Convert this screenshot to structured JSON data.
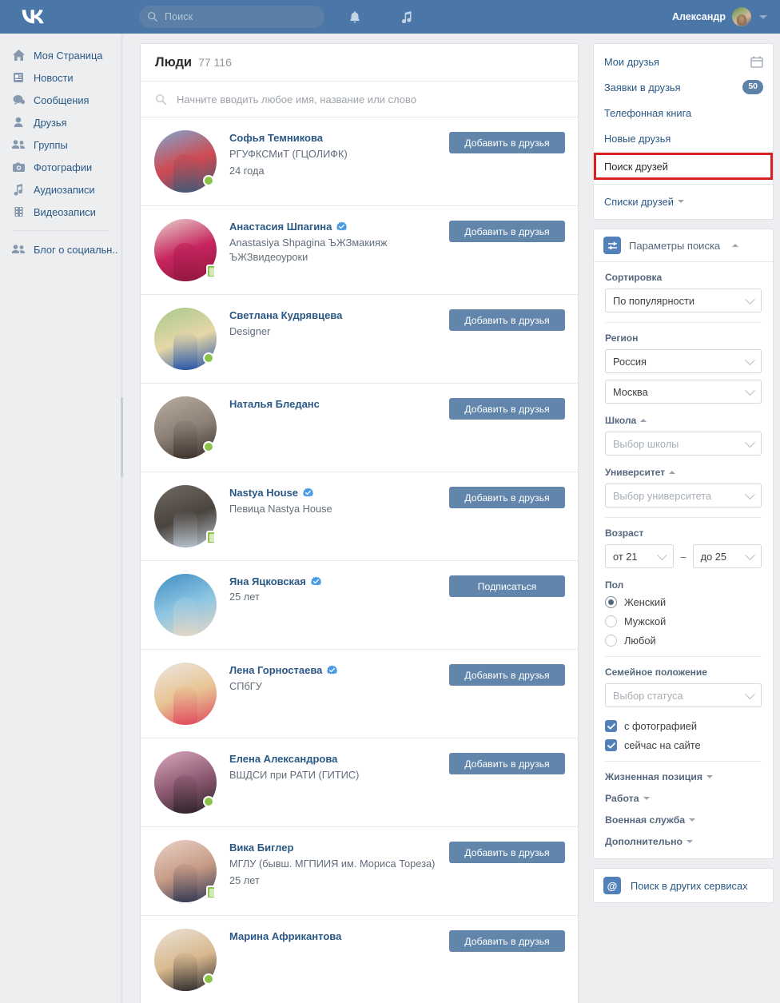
{
  "header": {
    "logo": "vk-logo",
    "search_placeholder": "Поиск",
    "notifications_icon": "bell-icon",
    "music_icon": "music-note-icon",
    "user_name": "Александр"
  },
  "left_nav": {
    "items": [
      {
        "icon": "home-icon",
        "label": "Моя Страница"
      },
      {
        "icon": "news-icon",
        "label": "Новости"
      },
      {
        "icon": "message-icon",
        "label": "Сообщения"
      },
      {
        "icon": "person-icon",
        "label": "Друзья"
      },
      {
        "icon": "people-icon",
        "label": "Группы"
      },
      {
        "icon": "camera-icon",
        "label": "Фотографии"
      },
      {
        "icon": "music-icon",
        "label": "Аудиозаписи"
      },
      {
        "icon": "film-icon",
        "label": "Видеозаписи"
      }
    ],
    "extra": {
      "icon": "people-icon",
      "label": "Блог о социальн.."
    }
  },
  "main": {
    "title": "Люди",
    "count": "77 116",
    "search_placeholder": "Начните вводить любое имя, название или слово",
    "users": [
      {
        "name": "Софья Темникова",
        "verified": false,
        "subtitle": "РГУФКСМиТ (ГЦОЛИФК)",
        "age": "24 года",
        "status": "online",
        "action": "Добавить в друзья",
        "avatar_colors": [
          "#7fa8cf",
          "#cf4a52",
          "#3c5a78"
        ]
      },
      {
        "name": "Анастасия Шпагина",
        "verified": true,
        "subtitle": "Anastasiya Shpagina ЪЖЗмакияж ЪЖЗвидеоуроки",
        "age": "",
        "status": "mobile",
        "action": "Добавить в друзья",
        "avatar_colors": [
          "#e8d3cc",
          "#c7245e",
          "#8e1740"
        ]
      },
      {
        "name": "Светлана Кудрявцева",
        "verified": false,
        "subtitle": "Designer",
        "age": "",
        "status": "online",
        "action": "Добавить в друзья",
        "avatar_colors": [
          "#a8c98b",
          "#e5d7a8",
          "#1f4fa8"
        ]
      },
      {
        "name": "Наталья Бледанс",
        "verified": false,
        "subtitle": "",
        "age": "",
        "status": "online",
        "action": "Добавить в друзья",
        "avatar_colors": [
          "#b8ada0",
          "#8d8177",
          "#3a2f2a"
        ]
      },
      {
        "name": "Nastya House",
        "verified": true,
        "subtitle": "Певица Nastya House",
        "age": "",
        "status": "mobile",
        "action": "Добавить в друзья",
        "avatar_colors": [
          "#6f6a63",
          "#4b443e",
          "#b9c6d2"
        ]
      },
      {
        "name": "Яна Яцковская",
        "verified": true,
        "subtitle": "",
        "age": "25 лет",
        "status": "none",
        "action": "Подписаться",
        "avatar_colors": [
          "#3f8ec4",
          "#8fc6e2",
          "#e7d8c6"
        ]
      },
      {
        "name": "Лена Горностаева",
        "verified": true,
        "subtitle": "СПбГУ",
        "age": "",
        "status": "none",
        "action": "Добавить в друзья",
        "avatar_colors": [
          "#ece7e2",
          "#e8c493",
          "#e0465c"
        ]
      },
      {
        "name": "Елена Александрова",
        "verified": false,
        "subtitle": "ВШДСИ при РАТИ (ГИТИС)",
        "age": "",
        "status": "online",
        "action": "Добавить в друзья",
        "avatar_colors": [
          "#d9a7bd",
          "#8e5a73",
          "#2a2126"
        ]
      },
      {
        "name": "Вика Биглер",
        "verified": false,
        "subtitle": "МГЛУ (бывш. МГПИИЯ им. Мориса Тореза)",
        "age": "25 лет",
        "status": "mobile",
        "action": "Добавить в друзья",
        "avatar_colors": [
          "#e9d2c5",
          "#c79a86",
          "#2d3551"
        ]
      },
      {
        "name": "Марина Африкантова",
        "verified": false,
        "subtitle": "",
        "age": "",
        "status": "online",
        "action": "Добавить в друзья",
        "avatar_colors": [
          "#e9e2d8",
          "#d9b98e",
          "#2c2a2c"
        ]
      }
    ]
  },
  "right": {
    "friends_menu": [
      {
        "label": "Мои друзья",
        "icon": "calendar-icon",
        "badge": "",
        "highlighted": false
      },
      {
        "label": "Заявки в друзья",
        "icon": "",
        "badge": "50",
        "highlighted": false
      },
      {
        "label": "Телефонная книга",
        "icon": "",
        "badge": "",
        "highlighted": false
      },
      {
        "label": "Новые друзья",
        "icon": "",
        "badge": "",
        "highlighted": false
      },
      {
        "label": "Поиск друзей",
        "icon": "",
        "badge": "",
        "highlighted": true
      }
    ],
    "friends_lists_label": "Списки друзей",
    "params": {
      "icon": "sliders-icon",
      "title": "Параметры поиска",
      "sort": {
        "label": "Сортировка",
        "value": "По популярности"
      },
      "region": {
        "label": "Регион",
        "country": "Россия",
        "city": "Москва"
      },
      "school": {
        "label": "Школа",
        "placeholder": "Выбор школы"
      },
      "university": {
        "label": "Университет",
        "placeholder": "Выбор университета"
      },
      "age": {
        "label": "Возраст",
        "from": "от 21",
        "to": "до 25",
        "dash": "–"
      },
      "gender": {
        "label": "Пол",
        "options": [
          {
            "label": "Женский",
            "selected": true
          },
          {
            "label": "Мужской",
            "selected": false
          },
          {
            "label": "Любой",
            "selected": false
          }
        ]
      },
      "marital": {
        "label": "Семейное положение",
        "placeholder": "Выбор статуса"
      },
      "checkboxes": [
        {
          "label": "с фотографией",
          "checked": true
        },
        {
          "label": "сейчас на сайте",
          "checked": true
        }
      ],
      "collapsed_sections": [
        "Жизненная позиция",
        "Работа",
        "Военная служба",
        "Дополнительно"
      ]
    },
    "other_services": {
      "icon": "at-icon",
      "label": "Поиск в других сервисах"
    }
  },
  "colors": {
    "header_blue": "#4a76a8",
    "link_blue": "#2a5885",
    "button_blue": "#6285ab",
    "accent_blue": "#5181b8",
    "highlight_red": "#d92020",
    "online_green": "#8bc34a",
    "page_bg": "#edeef0"
  }
}
